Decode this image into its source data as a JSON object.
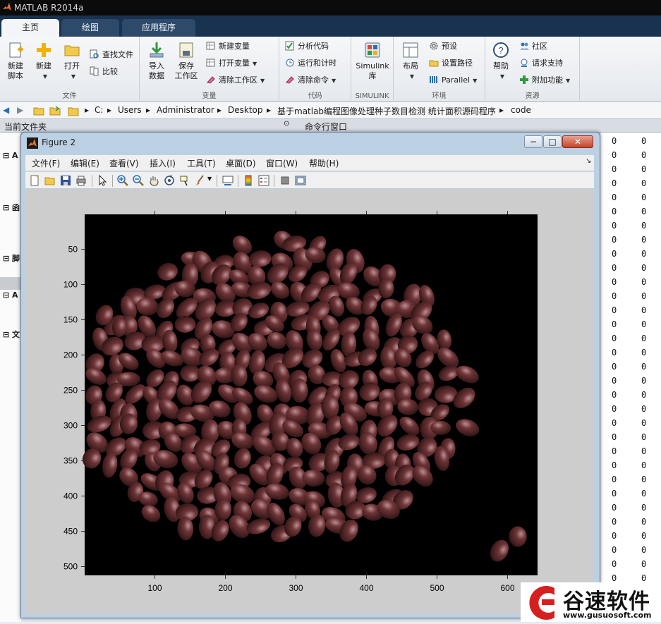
{
  "app": {
    "title": "MATLAB R2014a"
  },
  "tabs": [
    {
      "label": "主页"
    },
    {
      "label": "绘图"
    },
    {
      "label": "应用程序"
    }
  ],
  "ribbon": {
    "file": {
      "group_label": "文件",
      "new_script": [
        "新建",
        "脚本"
      ],
      "new": "新建",
      "open": "打开",
      "find_files": "查找文件",
      "compare": "比较"
    },
    "variable": {
      "group_label": "变量",
      "import": [
        "导入",
        "数据"
      ],
      "save": [
        "保存",
        "工作区"
      ],
      "new_variable": "新建变量",
      "open_variable": "打开变量",
      "clear_workspace": "清除工作区"
    },
    "code": {
      "group_label": "代码",
      "analyze": "分析代码",
      "run_time": "运行和计时",
      "clear_commands": "清除命令"
    },
    "simulink": {
      "group_label": "SIMULINK",
      "lib": [
        "Simulink",
        "库"
      ]
    },
    "env": {
      "group_label": "环境",
      "layout": "布局",
      "prefs": "预设",
      "set_path": "设置路径",
      "parallel": "Parallel"
    },
    "resources": {
      "group_label": "资源",
      "help": "帮助",
      "community": "社区",
      "support": "请求支持",
      "addons": "附加功能"
    }
  },
  "address": {
    "path": [
      "C:",
      "Users",
      "Administrator",
      "Desktop",
      "基于matlab编程图像处理种子数目检测 统计面积源码程序",
      "code"
    ]
  },
  "panels": {
    "current_folder": "当前文件夹",
    "command_window": "命令行窗口",
    "left_sections": [
      "A",
      "函",
      "脚",
      "A",
      "文"
    ]
  },
  "zero_column_value": "0",
  "figure": {
    "title": "Figure 2",
    "menus": [
      "文件(F)",
      "编辑(E)",
      "查看(V)",
      "插入(I)",
      "工具(T)",
      "桌面(D)",
      "窗口(W)",
      "帮助(H)"
    ],
    "toolbar_icons": [
      "new-figure-icon",
      "open-file-icon",
      "save-icon",
      "print-icon",
      "pointer-icon",
      "zoom-in-icon",
      "zoom-out-icon",
      "pan-icon",
      "rotate-3d-icon",
      "data-cursor-icon",
      "brush-icon",
      "link-plot-icon",
      "colorbar-icon",
      "legend-icon",
      "hide-plot-tools-icon",
      "show-plot-tools-icon"
    ],
    "axes": {
      "x_ticks": [
        "100",
        "200",
        "300",
        "400",
        "500",
        "600"
      ],
      "y_ticks": [
        "50",
        "100",
        "150",
        "200",
        "250",
        "300",
        "350",
        "400",
        "450",
        "500"
      ]
    },
    "image_description": "black background with many dark red beans"
  },
  "watermark": {
    "name": "谷速软件",
    "url": "www.gusuosoft.com"
  },
  "colors": {
    "tab_dark": "#18324f",
    "bean": "#5a2a2c",
    "bean_highlight": "#b98e93"
  }
}
